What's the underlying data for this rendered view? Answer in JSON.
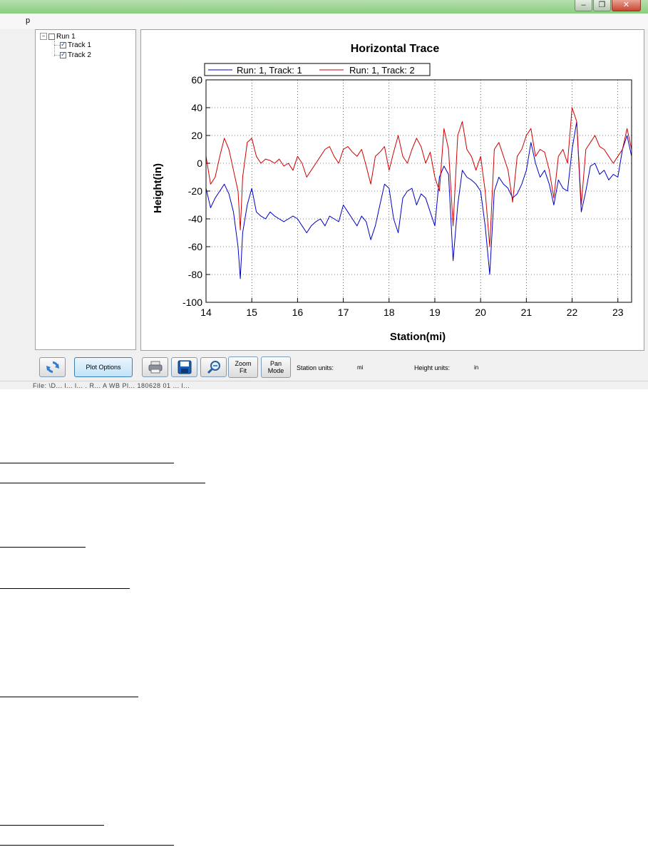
{
  "window": {
    "controls": [
      "minimize",
      "maximize",
      "close"
    ],
    "menu_fragment": "p"
  },
  "tree": {
    "root": {
      "label": "Run 1",
      "checked": false
    },
    "children": [
      {
        "label": "Track 1",
        "checked": true
      },
      {
        "label": "Track 2",
        "checked": true
      }
    ]
  },
  "chart_data": {
    "type": "line",
    "title": "Horizontal Trace",
    "xlabel": "Station(mi)",
    "ylabel": "Height(in)",
    "xlim": [
      14,
      23.3
    ],
    "ylim": [
      -100,
      60
    ],
    "xticks": [
      14,
      15,
      16,
      17,
      18,
      19,
      20,
      21,
      22,
      23
    ],
    "yticks": [
      -100,
      -80,
      -60,
      -40,
      -20,
      0,
      20,
      40,
      60
    ],
    "grid": true,
    "legend": "top",
    "series": [
      {
        "name": "Run: 1, Track: 1",
        "color": "#0000c8",
        "x": [
          14.0,
          14.1,
          14.2,
          14.3,
          14.4,
          14.5,
          14.6,
          14.7,
          14.75,
          14.8,
          14.9,
          15.0,
          15.1,
          15.2,
          15.3,
          15.4,
          15.5,
          15.6,
          15.7,
          15.8,
          15.9,
          16.0,
          16.1,
          16.2,
          16.3,
          16.4,
          16.5,
          16.6,
          16.7,
          16.8,
          16.9,
          17.0,
          17.1,
          17.2,
          17.3,
          17.4,
          17.5,
          17.6,
          17.7,
          17.8,
          17.9,
          18.0,
          18.1,
          18.2,
          18.3,
          18.4,
          18.5,
          18.6,
          18.7,
          18.8,
          18.9,
          19.0,
          19.1,
          19.2,
          19.3,
          19.4,
          19.5,
          19.6,
          19.7,
          19.8,
          19.9,
          20.0,
          20.1,
          20.2,
          20.3,
          20.4,
          20.5,
          20.6,
          20.7,
          20.8,
          20.9,
          21.0,
          21.1,
          21.2,
          21.3,
          21.4,
          21.5,
          21.6,
          21.7,
          21.8,
          21.9,
          22.0,
          22.1,
          22.2,
          22.3,
          22.4,
          22.5,
          22.6,
          22.7,
          22.8,
          22.9,
          23.0,
          23.1,
          23.2,
          23.3
        ],
        "y": [
          -18,
          -32,
          -25,
          -20,
          -15,
          -22,
          -35,
          -60,
          -83,
          -50,
          -30,
          -18,
          -35,
          -38,
          -40,
          -35,
          -38,
          -40,
          -42,
          -40,
          -38,
          -40,
          -45,
          -50,
          -45,
          -42,
          -40,
          -45,
          -38,
          -40,
          -42,
          -30,
          -35,
          -40,
          -45,
          -38,
          -42,
          -55,
          -45,
          -30,
          -15,
          -18,
          -40,
          -50,
          -25,
          -20,
          -18,
          -30,
          -22,
          -25,
          -35,
          -45,
          -10,
          -2,
          -8,
          -70,
          -30,
          -5,
          -10,
          -12,
          -15,
          -20,
          -45,
          -80,
          -20,
          -10,
          -15,
          -18,
          -25,
          -22,
          -15,
          -5,
          15,
          0,
          -10,
          -5,
          -15,
          -30,
          -12,
          -18,
          -20,
          10,
          30,
          -35,
          -20,
          -2,
          0,
          -8,
          -5,
          -12,
          -8,
          -10,
          10,
          20,
          5
        ]
      },
      {
        "name": "Run: 1, Track: 2",
        "color": "#d00000",
        "x": [
          14.0,
          14.1,
          14.2,
          14.3,
          14.4,
          14.5,
          14.6,
          14.7,
          14.75,
          14.8,
          14.9,
          15.0,
          15.1,
          15.2,
          15.3,
          15.4,
          15.5,
          15.6,
          15.7,
          15.8,
          15.9,
          16.0,
          16.1,
          16.2,
          16.3,
          16.4,
          16.5,
          16.6,
          16.7,
          16.8,
          16.9,
          17.0,
          17.1,
          17.2,
          17.3,
          17.4,
          17.5,
          17.6,
          17.7,
          17.8,
          17.9,
          18.0,
          18.1,
          18.2,
          18.3,
          18.4,
          18.5,
          18.6,
          18.7,
          18.8,
          18.9,
          19.0,
          19.1,
          19.2,
          19.3,
          19.4,
          19.5,
          19.6,
          19.7,
          19.8,
          19.9,
          20.0,
          20.1,
          20.2,
          20.3,
          20.4,
          20.5,
          20.6,
          20.7,
          20.8,
          20.9,
          21.0,
          21.1,
          21.2,
          21.3,
          21.4,
          21.5,
          21.6,
          21.7,
          21.8,
          21.9,
          22.0,
          22.1,
          22.2,
          22.3,
          22.4,
          22.5,
          22.6,
          22.7,
          22.8,
          22.9,
          23.0,
          23.1,
          23.2,
          23.3
        ],
        "y": [
          5,
          -15,
          -10,
          5,
          18,
          10,
          -5,
          -20,
          -48,
          -10,
          15,
          18,
          5,
          0,
          3,
          2,
          0,
          3,
          -2,
          0,
          -5,
          5,
          0,
          -10,
          -5,
          0,
          5,
          10,
          12,
          5,
          0,
          10,
          12,
          8,
          5,
          10,
          -2,
          -15,
          5,
          8,
          12,
          -5,
          8,
          20,
          5,
          0,
          10,
          18,
          12,
          0,
          8,
          -10,
          -20,
          25,
          10,
          -45,
          20,
          30,
          10,
          5,
          -5,
          5,
          -20,
          -60,
          10,
          15,
          5,
          -5,
          -28,
          5,
          10,
          20,
          25,
          5,
          10,
          8,
          -5,
          -25,
          5,
          10,
          0,
          40,
          30,
          -30,
          10,
          15,
          20,
          12,
          10,
          5,
          0,
          5,
          10,
          25,
          10
        ]
      }
    ]
  },
  "toolbar": {
    "plot_options_label": "Plot Options",
    "zoom_fit_line1": "Zoom",
    "zoom_fit_line2": "Fit",
    "pan_mode_line1": "Pan",
    "pan_mode_line2": "Mode",
    "station_units_label": "Station units:",
    "station_units_value": "mi",
    "height_units_label": "Height units:",
    "height_units_value": "in"
  },
  "statusbar": {
    "file_fragment": "File: \\D... l... l... . R... A WB  Pl... 180628  01 ... l..."
  },
  "colors": {
    "titlebar": "#8ccd82",
    "track1": "#0000c8",
    "track2": "#d00000"
  },
  "icons": [
    "refresh-icon",
    "printer-icon",
    "save-disk-icon",
    "magnifier-icon"
  ]
}
